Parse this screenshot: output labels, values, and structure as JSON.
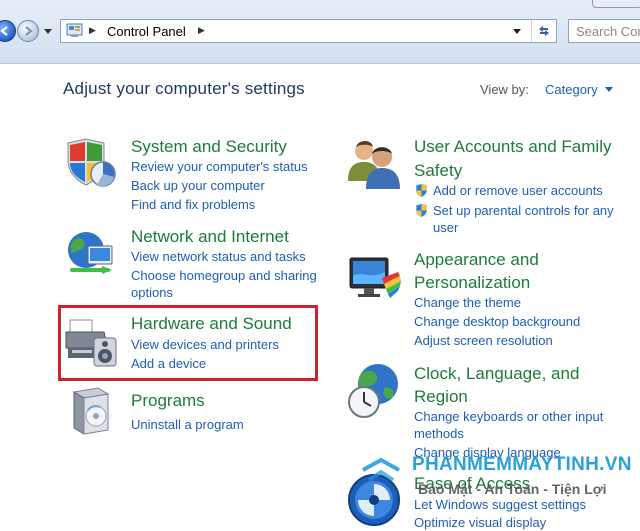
{
  "address_bar": {
    "breadcrumb": "Control Panel"
  },
  "search": {
    "placeholder": "Search Con"
  },
  "main": {
    "heading": "Adjust your computer's settings",
    "view_by_label": "View by:",
    "view_by_value": "Category"
  },
  "categories": {
    "system_security": {
      "title": "System and Security",
      "links": [
        "Review your computer's status",
        "Back up your computer",
        "Find and fix problems"
      ]
    },
    "network_internet": {
      "title": "Network and Internet",
      "links": [
        "View network status and tasks",
        "Choose homegroup and sharing",
        "options"
      ]
    },
    "hardware_sound": {
      "title": "Hardware and Sound",
      "links": [
        "View devices and printers",
        "Add a device"
      ]
    },
    "programs": {
      "title": "Programs",
      "links": [
        "Uninstall a program"
      ]
    },
    "user_accounts": {
      "title_line1": "User Accounts and Family",
      "title_line2": "Safety",
      "links": [
        "Add or remove user accounts",
        "Set up parental controls for any",
        "user"
      ]
    },
    "appearance": {
      "title_line1": "Appearance and",
      "title_line2": "Personalization",
      "links": [
        "Change the theme",
        "Change desktop background",
        "Adjust screen resolution"
      ]
    },
    "clock_language": {
      "title_line1": "Clock, Language, and",
      "title_line2": "Region",
      "links": [
        "Change keyboards or other input",
        "methods",
        "Change display language"
      ]
    },
    "ease_of_access": {
      "title": "Ease of Access",
      "links": [
        "Let Windows suggest settings",
        "Optimize visual display"
      ]
    }
  },
  "watermark": {
    "site": "PHANMEMMAYTINH.VN",
    "tagline": "Bảo Mật - An Toàn - Tiện Lợi"
  },
  "colors": {
    "category_title": "#1e7b3a",
    "link": "#1e5fb4",
    "highlight_border": "#d3202c",
    "heading": "#1e395b"
  },
  "icons": {
    "system_security": "shield-chart-icon",
    "network_internet": "globe-network-icon",
    "hardware_sound": "printer-speaker-icon",
    "programs": "software-box-icon",
    "user_accounts": "users-icon",
    "appearance": "monitor-paint-icon",
    "clock_language": "globe-clock-icon",
    "ease_of_access": "ease-of-access-icon"
  }
}
